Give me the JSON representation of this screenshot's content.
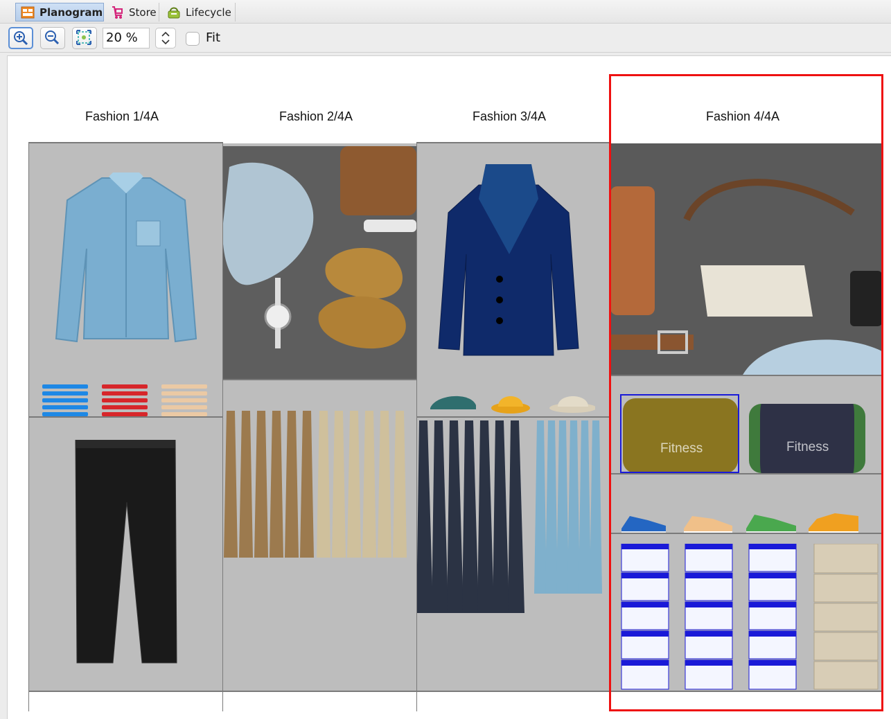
{
  "tabs": [
    {
      "label": "Planogram",
      "active": true
    },
    {
      "label": "Store",
      "active": false
    },
    {
      "label": "Lifecycle",
      "active": false
    }
  ],
  "toolbar": {
    "zoom_value": "20 %",
    "fit_label": "Fit",
    "fit_checked": false
  },
  "bays": [
    {
      "title": "Fashion 1/4A"
    },
    {
      "title": "Fashion 2/4A"
    },
    {
      "title": "Fashion 3/4A"
    },
    {
      "title": "Fashion 4/4A",
      "selected": true
    }
  ],
  "products": {
    "bag_1_label": "Fitness",
    "bag_2_label": "Fitness"
  },
  "colors": {
    "selection": "#ee1111",
    "product_selection": "#1a1ad8",
    "shelf_background": "#bdbdbd",
    "active_tab": "#b6cdea"
  }
}
